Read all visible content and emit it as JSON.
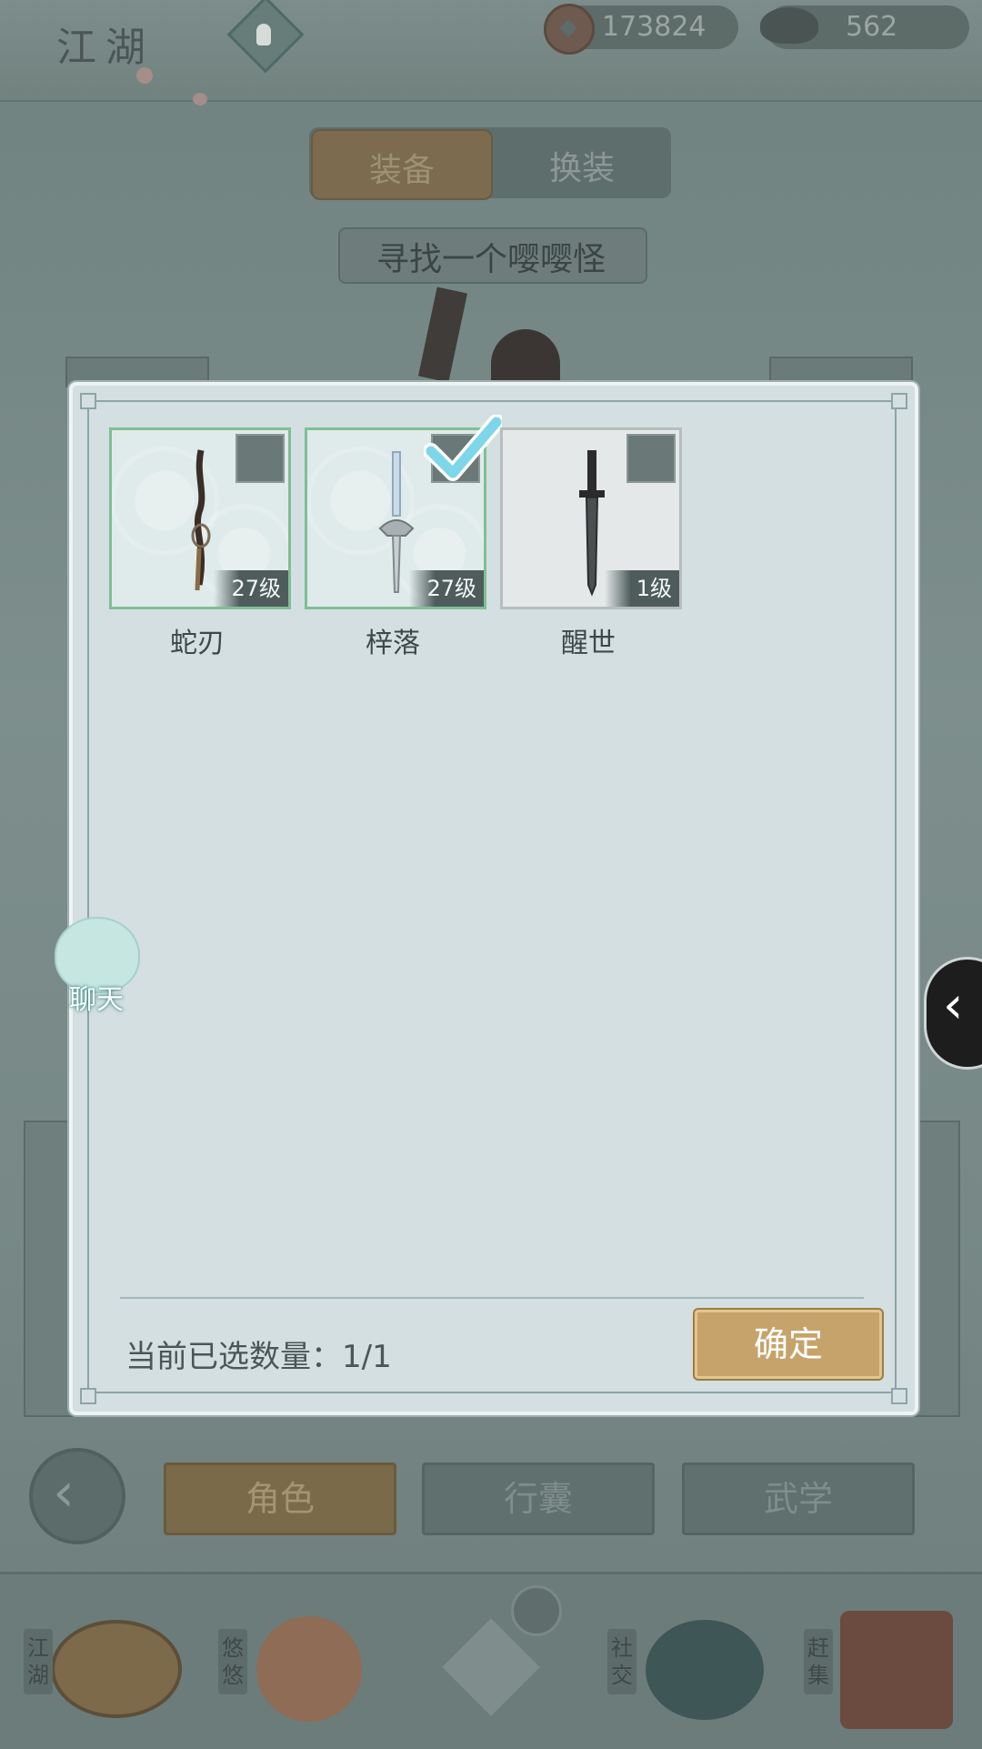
{
  "header": {
    "brand": "江湖",
    "copper": "173824",
    "silver": "562"
  },
  "tabs": [
    {
      "label": "装备",
      "active": true
    },
    {
      "label": "换装",
      "active": false
    }
  ],
  "quest": "寻找一个嘤嘤怪",
  "modal": {
    "items": [
      {
        "name": "蛇刃",
        "level": "27级",
        "checked": false
      },
      {
        "name": "梓落",
        "level": "27级",
        "checked": true
      },
      {
        "name": "醒世",
        "level": "1级",
        "checked": false
      }
    ],
    "selected_count": "当前已选数量：1/1",
    "confirm": "确定"
  },
  "chat": {
    "label": "聊天"
  },
  "nav": {
    "role": "角色",
    "bag": "行囊",
    "skills": "武学"
  },
  "dock": [
    {
      "label": "江湖",
      "icon": "straw-hat-icon"
    },
    {
      "label": "悠悠",
      "icon": "crane-sun-icon"
    },
    {
      "label": "",
      "icon": "compass-star-icon"
    },
    {
      "label": "社交",
      "icon": "wave-bowl-icon"
    },
    {
      "label": "赶集",
      "icon": "market-basket-icon"
    }
  ],
  "colors": {
    "accent": "#c6a36a",
    "selected_border": "#7fbf93",
    "check": "#7ed6ea"
  }
}
